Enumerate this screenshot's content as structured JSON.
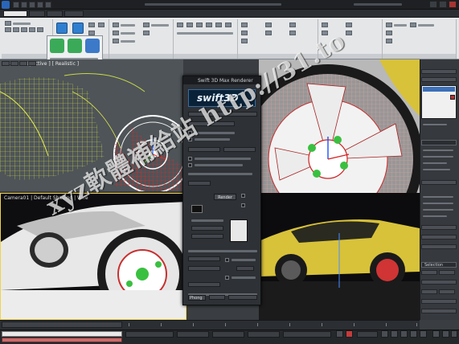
{
  "dialog": {
    "title": "Swift 3D Max Renderer",
    "logo": "swift3D",
    "render_button": "Render",
    "phong_label": "Phong"
  },
  "viewports": {
    "bottom_left_label": "Camera01 | Default Shading | Wire"
  },
  "command_panel": {
    "selection_header": "Selection"
  },
  "watermark": "xyz軟體補給站 http://31.to",
  "colors": {
    "ribbon_bg": "#e4e6e8",
    "dialog_bg": "#2e3135",
    "viewport_border": "#f2d24a",
    "car_yellow": "#d8c23a",
    "selection_red": "#cc2222",
    "status_pink": "#c96b6b"
  },
  "icons": [
    "app-logo-icon",
    "undo-icon",
    "redo-icon",
    "save-icon",
    "minimize-icon",
    "maximize-icon",
    "close-icon",
    "play-icon",
    "key-icon"
  ]
}
